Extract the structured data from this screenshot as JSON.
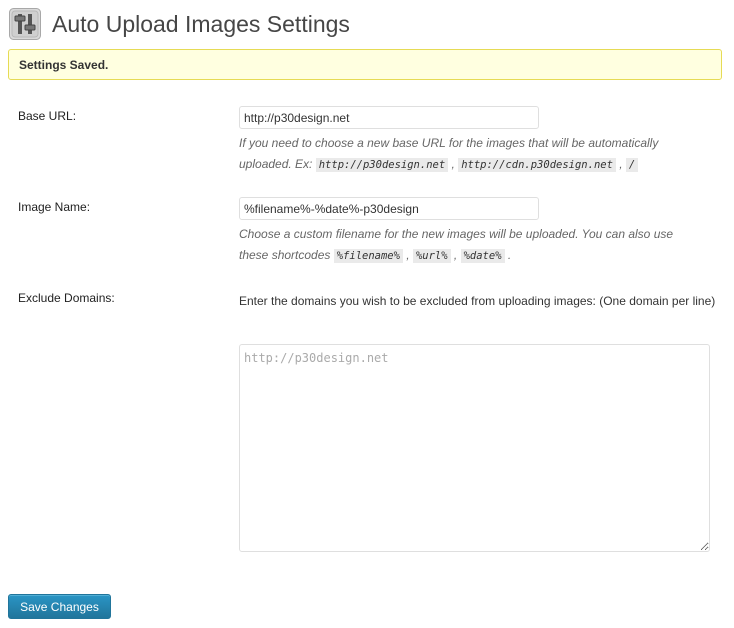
{
  "header": {
    "title": "Auto Upload Images Settings",
    "icon": "settings-sliders-icon"
  },
  "notice": {
    "text": "Settings Saved."
  },
  "fields": {
    "base_url": {
      "label": "Base URL:",
      "value": "http://p30design.net",
      "description_prefix": "If you need to choose a new base URL for the images that will be automatically",
      "description_line2_prefix": "uploaded. Ex:",
      "examples": [
        "http://p30design.net",
        "http://cdn.p30design.net",
        "/"
      ]
    },
    "image_name": {
      "label": "Image Name:",
      "value": "%filename%-%date%-p30design",
      "description_prefix": "Choose a custom filename for the new images will be uploaded. You can also use",
      "description_line2_prefix": "these shortcodes",
      "shortcodes": [
        "%filename%",
        "%url%",
        "%date%"
      ]
    },
    "exclude_domains": {
      "label": "Exclude Domains:",
      "intro": "Enter the domains you wish to be excluded from uploading images: (One domain per line)",
      "placeholder": "http://p30design.net",
      "value": ""
    }
  },
  "actions": {
    "save_label": "Save Changes"
  },
  "colors": {
    "notice_background": "#ffffe0",
    "notice_border": "#e6db55",
    "primary_button": "#21759b"
  }
}
